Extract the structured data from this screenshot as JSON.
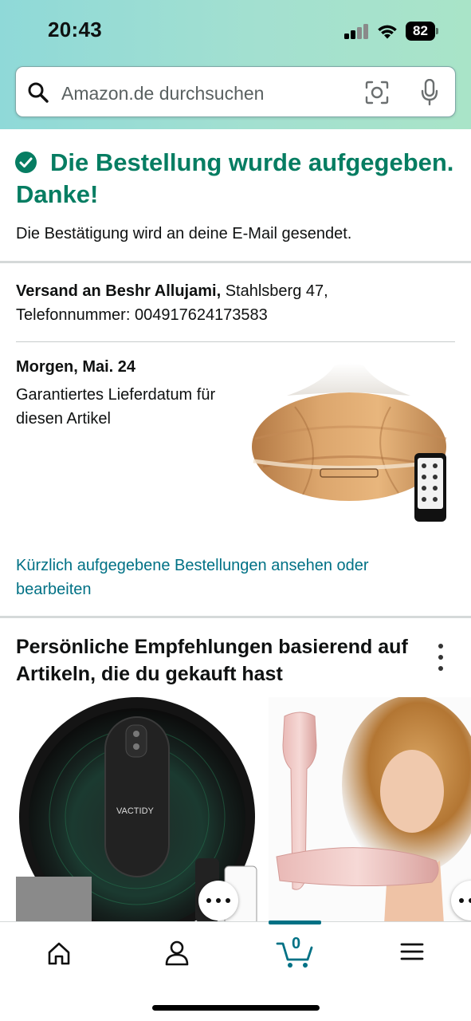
{
  "status_bar": {
    "time": "20:43",
    "battery": "82"
  },
  "search": {
    "placeholder": "Amazon.de durchsuchen"
  },
  "confirmation": {
    "title": "Die Bestellung wurde aufgegeben. Danke!",
    "subtitle": "Die Bestätigung wird an deine E-Mail gesendet."
  },
  "shipping": {
    "label": "Versand an Beshr Allujami,",
    "address": " Stahlsberg 47,",
    "phone": "Telefonnummer: 004917624173583"
  },
  "delivery": {
    "date": "Morgen, Mai. 24",
    "note": "Garantiertes Lieferdatum für diesen Artikel"
  },
  "orders_link": "Kürzlich aufgegebene Bestellungen ansehen oder bearbeiten",
  "recommendations": {
    "title": "Persönliche Empfehlungen basierend auf Artikeln, die du gekauft hast",
    "robot_brand": "VACTIDY"
  },
  "cart": {
    "count": "0"
  },
  "colors": {
    "accent": "#067d62",
    "link": "#007185"
  }
}
